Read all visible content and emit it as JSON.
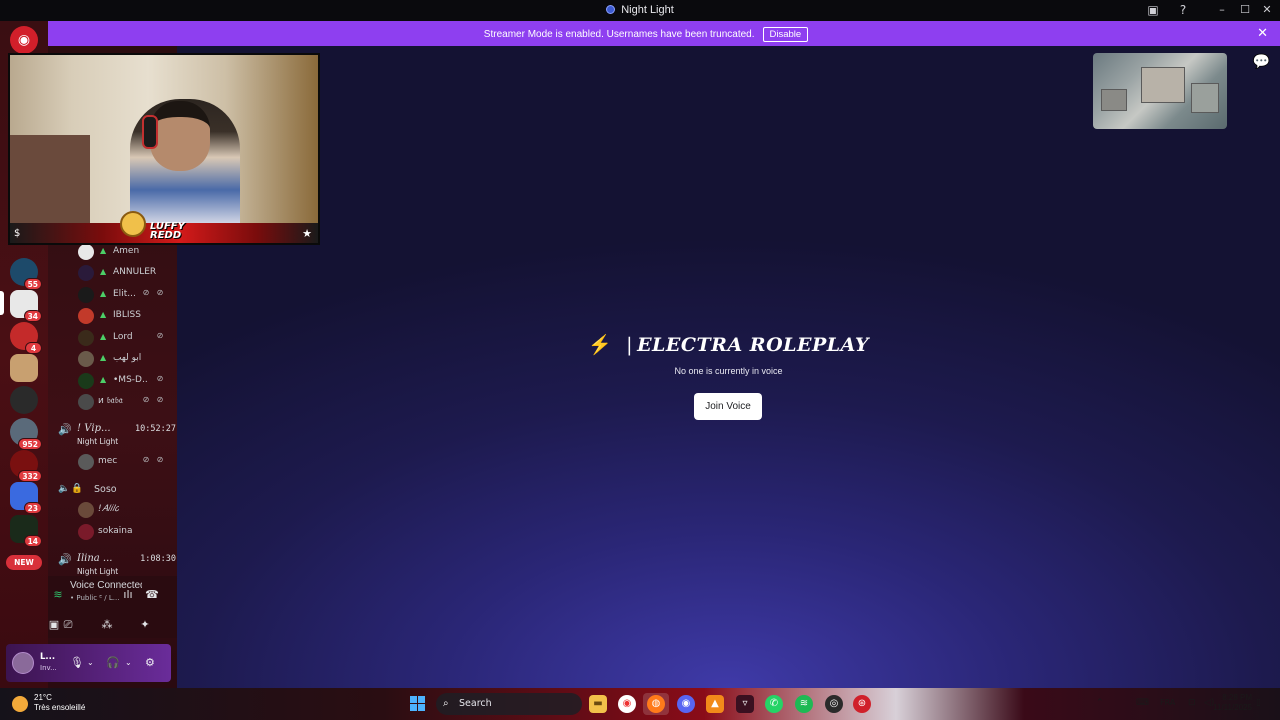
{
  "window": {
    "title": "Night Light"
  },
  "banner": {
    "text": "Streamer Mode is enabled. Usernames have been truncated.",
    "button": "Disable"
  },
  "servers": [
    {
      "badge": "55"
    },
    {
      "badge": "34"
    },
    {
      "badge": "4"
    },
    {
      "badge": ""
    },
    {
      "badge": ""
    },
    {
      "badge": "952"
    },
    {
      "badge": "332"
    },
    {
      "badge": "23"
    },
    {
      "badge": "14"
    }
  ],
  "new_label": "NEW",
  "members": [
    {
      "name": "Amen",
      "crown": true
    },
    {
      "name": "ANNULER",
      "crown": true
    },
    {
      "name": "Elit...",
      "crown": true
    },
    {
      "name": "IBLISS",
      "crown": true
    },
    {
      "name": "Lord",
      "crown": true
    },
    {
      "name": "ابو لهب",
      "crown": true
    },
    {
      "name": "•MS-D...",
      "crown": true
    },
    {
      "name": "ᴎ 𝔟𝔞𝔟𝔞",
      "crown": false
    }
  ],
  "channels": {
    "vip": {
      "name": "! 𝑉𝑖𝑝...",
      "time": "10:52:27",
      "sub": "Night Light",
      "member": "mec"
    },
    "soso": {
      "name": "Soso",
      "members": [
        "!𝐴𝑙𝑖𝑙𝑜",
        "sokaina"
      ]
    },
    "ilina": {
      "name": "Ilina ...",
      "time": "1:08:30",
      "sub": "Night Light"
    }
  },
  "voice": {
    "status": "Voice Connected",
    "sub": "• Public ᴱ / L..."
  },
  "user": {
    "name": "L...",
    "status": "Inv..."
  },
  "stage": {
    "title": "ELECTRA ROLEPLAY",
    "separator": "|",
    "subtitle": "No one is currently in voice",
    "join": "Join Voice"
  },
  "cam": {
    "name_line1": "LUFFY",
    "name_line2": "REDD"
  },
  "taskbar": {
    "temp": "21°C",
    "weather": "Très ensoleillé",
    "search": "Search",
    "lang": "FRA",
    "time": "8:28 PM",
    "date": "11/11/2025"
  },
  "colors": {
    "banner": "#8e3ff0",
    "accent": "#f5a14a",
    "badge": "#e03a3f"
  }
}
